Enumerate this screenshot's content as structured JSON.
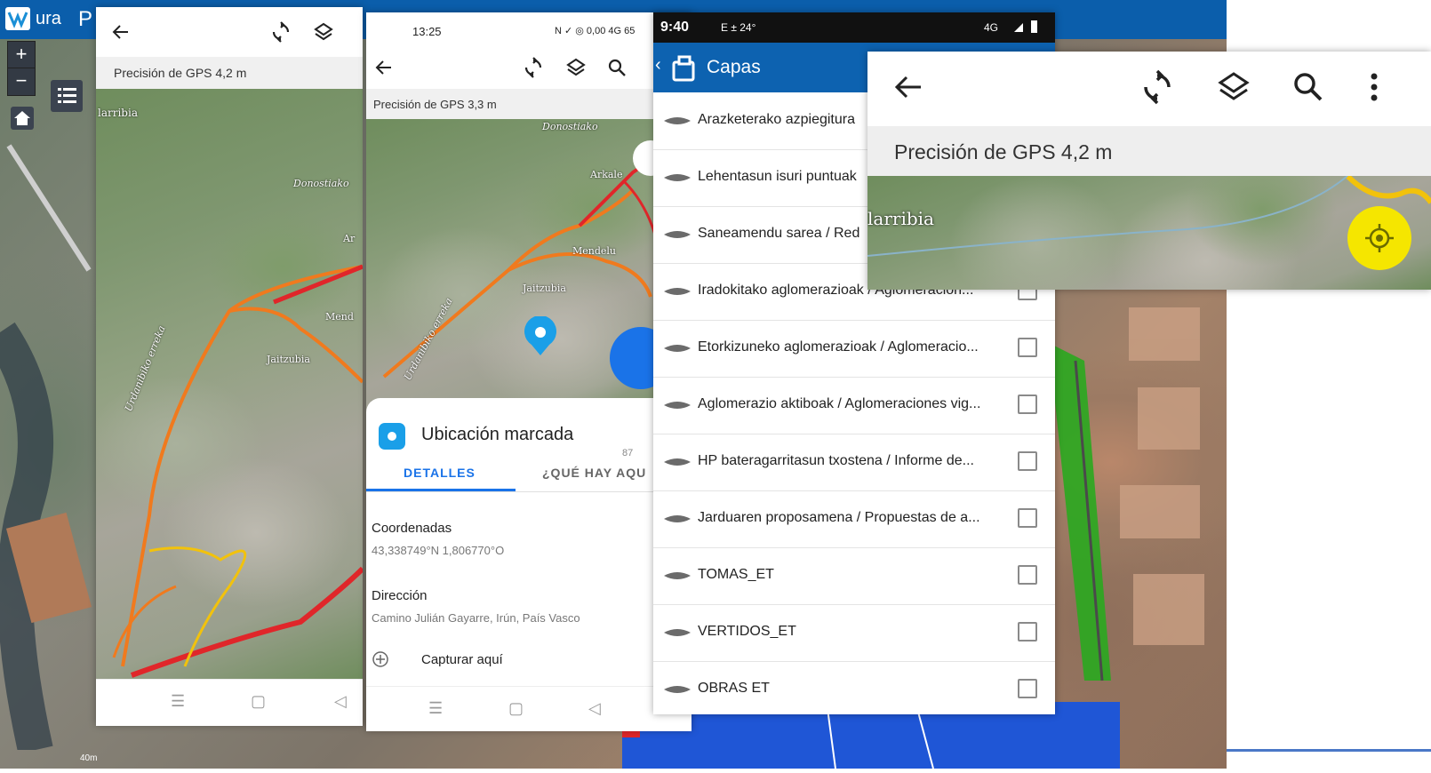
{
  "desktop": {
    "logo_text": "ura",
    "header_letter": "P",
    "zoom_in": "+",
    "zoom_out": "−",
    "scale_label": "40m"
  },
  "phone1": {
    "gps_label": "Precisión de GPS 4,2 m",
    "map_labels": [
      "larribia",
      "Donostiako",
      "Mend",
      "Jaitzubia",
      "Urdanibiko erreka",
      "Ar"
    ]
  },
  "phone2": {
    "time": "13:25",
    "status_icons": "N ✓ ◎ 0,00 4G 65",
    "gps_label": "Precisión de GPS 3,3 m",
    "map_labels": [
      "Donostiako",
      "Arkale",
      "Mendelu",
      "Jaitzubia",
      "Urdanibiko erreka"
    ],
    "sheet_title": "Ubicación marcada",
    "sheet_distance": "87",
    "tabs": [
      "DETALLES",
      "¿QUÉ HAY AQU"
    ],
    "coords_label": "Coordenadas",
    "coords_value": "43,338749°N 1,806770°O",
    "address_label": "Dirección",
    "address_value": "Camino Julián Gayarre, Irún, País Vasco",
    "capture_label": "Capturar aquí"
  },
  "phone3": {
    "time": "9:40",
    "status_left": "E ± 24°",
    "status_right": "4G",
    "title": "Capas",
    "layers": [
      {
        "label": "Arazketerako azpiegitura"
      },
      {
        "label": "Lehentasun isuri puntuak"
      },
      {
        "label": "Saneamendu sarea / Red"
      },
      {
        "label": "Iradokitako aglomerazioak / Aglomeracion..."
      },
      {
        "label": "Etorkizuneko aglomerazioak / Aglomeracio..."
      },
      {
        "label": "Aglomerazio aktiboak / Aglomeraciones vig..."
      },
      {
        "label": "HP bateragarritasun txostena / Informe de..."
      },
      {
        "label": "Jarduaren proposamena / Propuestas de a..."
      },
      {
        "label": "TOMAS_ET"
      },
      {
        "label": "VERTIDOS_ET"
      },
      {
        "label": "OBRAS ET"
      }
    ]
  },
  "zoomcard": {
    "gps_label": "Precisión de GPS 4,2 m",
    "map_label": "larribia"
  },
  "colors": {
    "accent_blue": "#1a73e8",
    "header_blue": "#0b5eab",
    "route_orange": "#f07a1e",
    "route_red": "#e0262a",
    "route_yellow": "#f2c20c",
    "location_yellow": "#f5e600"
  }
}
